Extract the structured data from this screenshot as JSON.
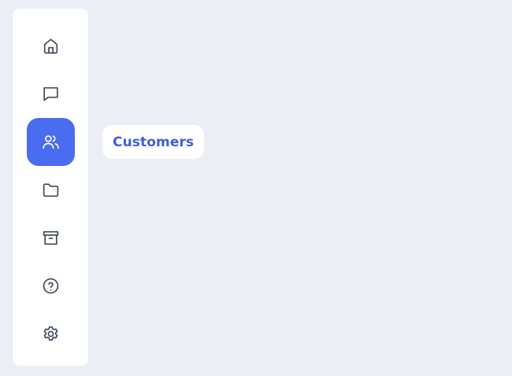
{
  "sidebar": {
    "items": [
      {
        "icon": "home-icon",
        "active": false
      },
      {
        "icon": "chat-icon",
        "active": false
      },
      {
        "icon": "users-icon",
        "active": true
      },
      {
        "icon": "folder-icon",
        "active": false
      },
      {
        "icon": "archive-icon",
        "active": false
      },
      {
        "icon": "help-icon",
        "active": false
      },
      {
        "icon": "gear-icon",
        "active": false
      }
    ]
  },
  "tooltip": {
    "label": "Customers"
  },
  "colors": {
    "background": "#ebeef5",
    "sidebar": "#ffffff",
    "accent": "#4a6cf0",
    "tooltip_text": "#3f5fd8",
    "icon": "#3f4a5a"
  }
}
